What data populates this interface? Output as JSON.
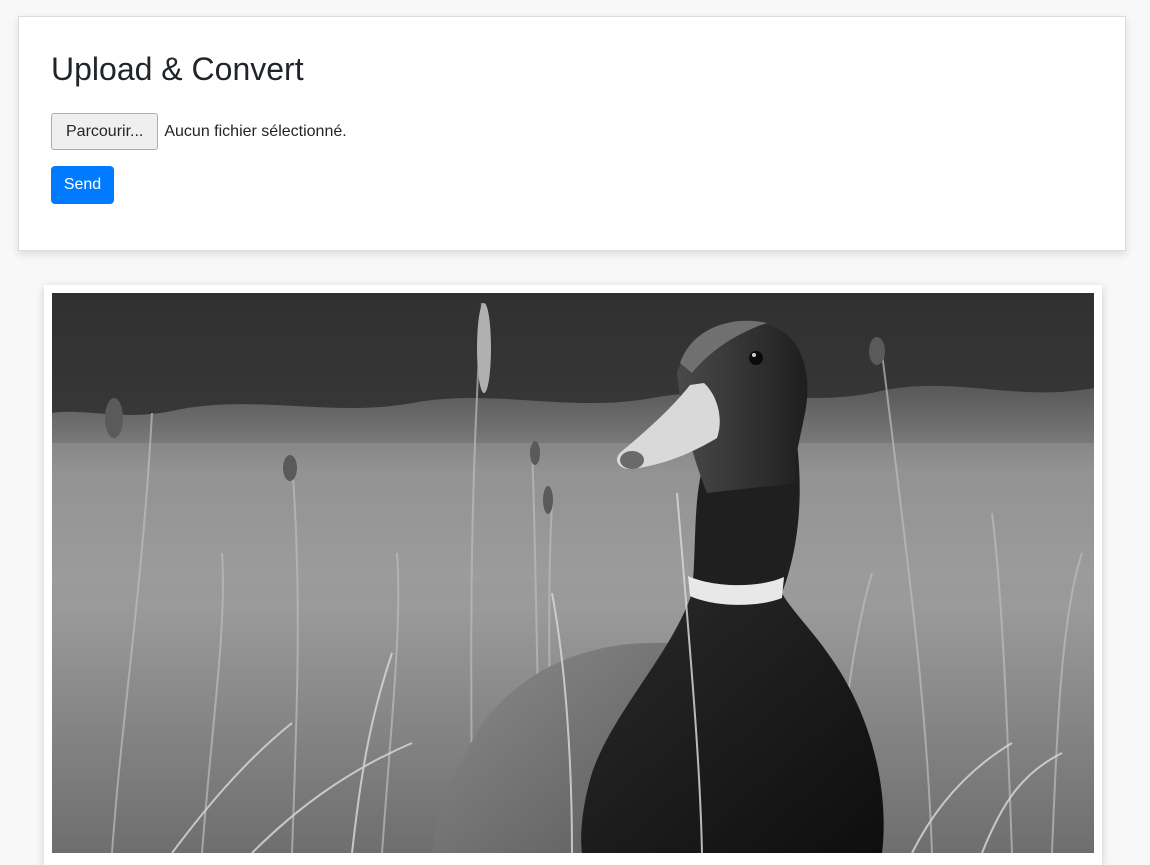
{
  "form": {
    "title": "Upload & Convert",
    "browse_label": "Parcourir...",
    "file_status": "Aucun fichier sélectionné.",
    "send_label": "Send"
  },
  "colors": {
    "accent": "#007bff",
    "page_bg": "#f8f8f8"
  }
}
